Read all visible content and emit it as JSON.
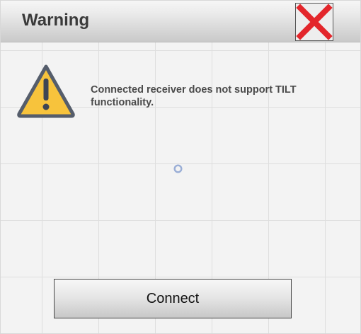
{
  "dialog": {
    "title": "Warning",
    "close_icon": "close-x-icon",
    "warning_icon": "warning-triangle-icon",
    "message": "Connected receiver does not support TILT functionality.",
    "spinner_icon": "loading-spinner-icon",
    "connect_label": "Connect"
  },
  "colors": {
    "close_x": "#e3262b",
    "warning_fill": "#f7c33c",
    "warning_border": "#555d6b",
    "spinner": "#9aaed6"
  }
}
